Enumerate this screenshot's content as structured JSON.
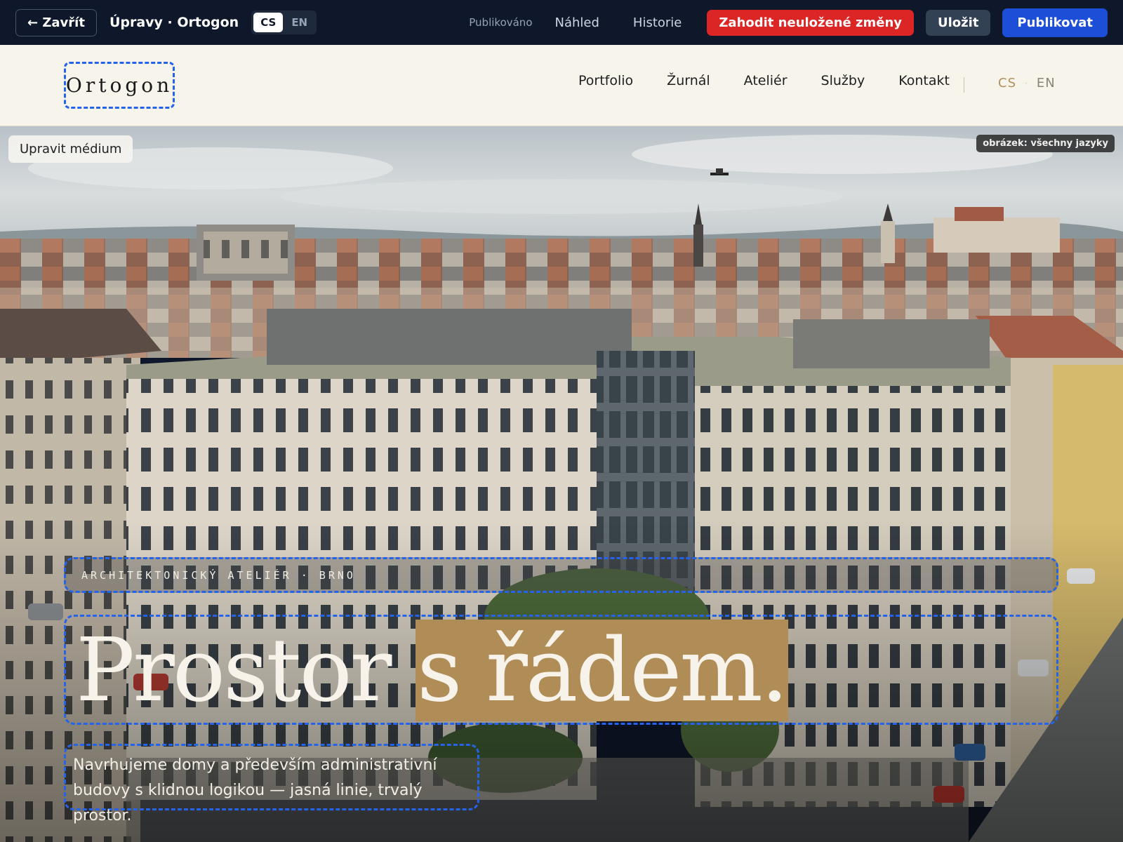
{
  "toolbar": {
    "close_label": "← Zavřít",
    "title": "Úpravy · Ortogon",
    "lang_active": "CS",
    "lang_other": "EN",
    "status": "Publikováno",
    "preview_label": "Náhled",
    "history_label": "Historie",
    "discard_label": "Zahodit neuložené změny",
    "save_label": "Uložit",
    "publish_label": "Publikovat",
    "colors": {
      "discard": "#dc2626",
      "publish": "#1d4ed8",
      "bar": "#0f172a"
    }
  },
  "site": {
    "logo": "Ortogon",
    "nav": [
      "Portfolio",
      "Žurnál",
      "Ateliér",
      "Služby",
      "Kontakt"
    ],
    "lang_cs": "CS",
    "lang_en": "EN",
    "accent": "#b08d57"
  },
  "hero": {
    "edit_media_label": "Upravit médium",
    "media_scope": "obrázek: všechny jazyky",
    "kicker": "ARCHITEKTONICKÝ ATELIÉR · BRNO",
    "headline_plain": "Prostor ",
    "headline_highlight": "s řádem.",
    "subtitle": "Navrhujeme domy a především administrativní budovy s klidnou logikou — jasná linie, trvalý prostor."
  }
}
